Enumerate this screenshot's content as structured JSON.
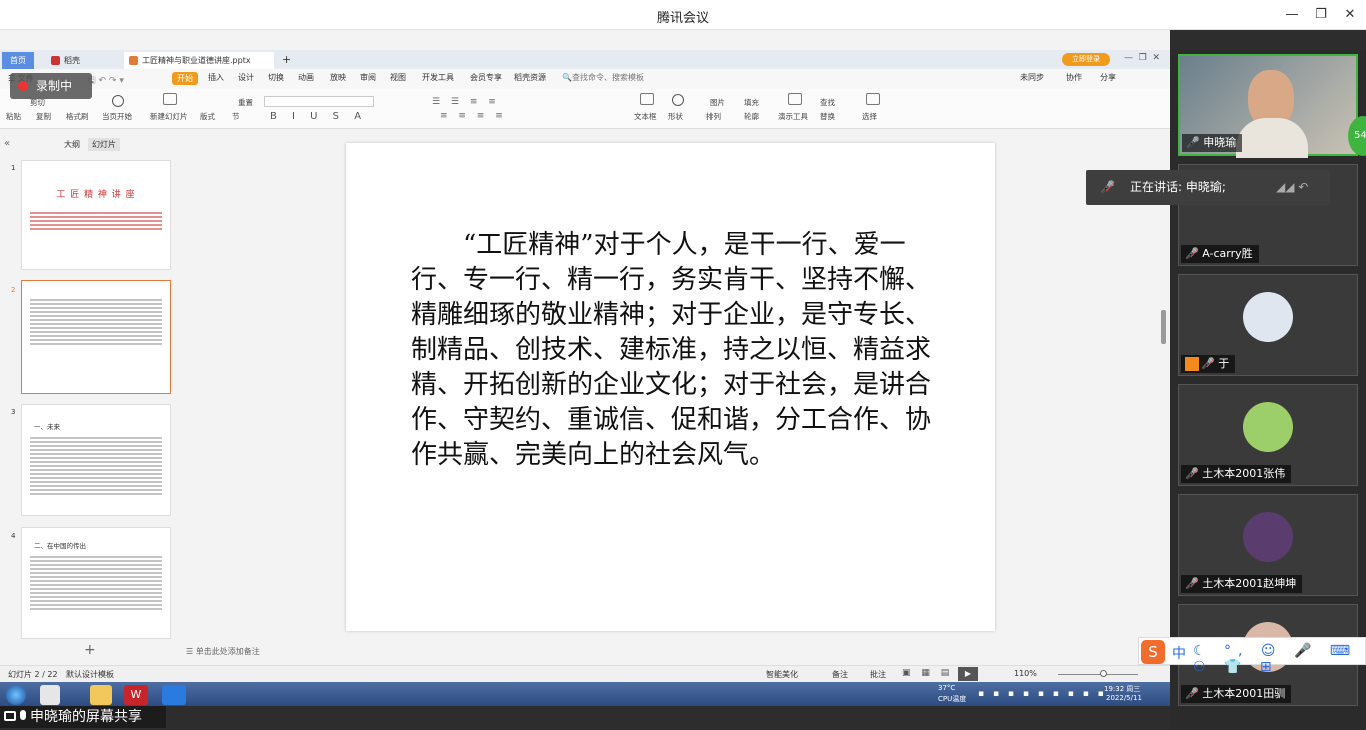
{
  "app": {
    "title": "腾讯会议"
  },
  "share": {
    "label": "申晓瑜的屏幕共享",
    "recording_label": "录制中"
  },
  "wps": {
    "tabs": [
      "首页",
      "稻壳",
      "工匠精神与职业道德讲座.pptx"
    ],
    "upgrade_button": "立即登录",
    "ribbon_tabs": [
      "开始",
      "插入",
      "设计",
      "切换",
      "动画",
      "放映",
      "审阅",
      "视图",
      "开发工具",
      "会员专享",
      "稻壳资源"
    ],
    "search_placeholder": "查找命令、搜索模板",
    "right_actions": [
      "未同步",
      "协作",
      "分享"
    ],
    "ribbon_buttons": [
      "粘贴",
      "剪切",
      "复制",
      "格式刷",
      "当页开始",
      "新建幻灯片",
      "版式",
      "节",
      "重置",
      "文本框",
      "形状",
      "排列",
      "轮廓",
      "演示工具",
      "替换",
      "选择",
      "查找",
      "图片",
      "填充"
    ],
    "panel_tabs": [
      "大纲",
      "幻灯片"
    ],
    "slide_thumbs": [
      {
        "num": "1",
        "title": "工 匠 精 神 讲 座"
      },
      {
        "num": "2",
        "title": ""
      },
      {
        "num": "3",
        "title": "一、未来"
      },
      {
        "num": "4",
        "title": "二、在中国的传出"
      }
    ],
    "slide_body": "“工匠精神”对于个人，是干一行、爱一行、专一行、精一行，务实肯干、坚持不懈、精雕细琢的敬业精神；对于企业，是守专长、制精品、创技术、建标准，持之以恒、精益求精、开拓创新的企业文化；对于社会，是讲合作、守契约、重诚信、促和谐，分工合作、协作共赢、完美向上的社会风气。",
    "notes_placeholder": "单击此处添加备注",
    "status": {
      "slide_count": "幻灯片 2 / 22",
      "template": "默认设计模板",
      "smart": "智能美化",
      "notes": "备注",
      "comments": "批注",
      "zoom": "110%"
    },
    "taskbar": {
      "temp": "37°C",
      "cpu": "CPU温度",
      "time": "19:32 周三",
      "date": "2022/5/11"
    }
  },
  "participants": [
    {
      "name": "申晓瑜",
      "active": true,
      "mic": "on",
      "badge": "54"
    },
    {
      "name": "A-carry胜",
      "mic": "muted"
    },
    {
      "name": "于",
      "mic": "muted"
    },
    {
      "name": "土木本2001张伟",
      "mic": "muted"
    },
    {
      "name": "土木本2001赵坤坤",
      "mic": "muted"
    },
    {
      "name": "土木本2001田驯",
      "mic": "muted"
    }
  ],
  "speaking": {
    "text": "正在讲话: 申晓瑜;"
  },
  "ime": {
    "mode": "中"
  },
  "colors": {
    "accent": "#3fb540",
    "wps_orange": "#e07b3a",
    "wps_red": "#c33"
  }
}
